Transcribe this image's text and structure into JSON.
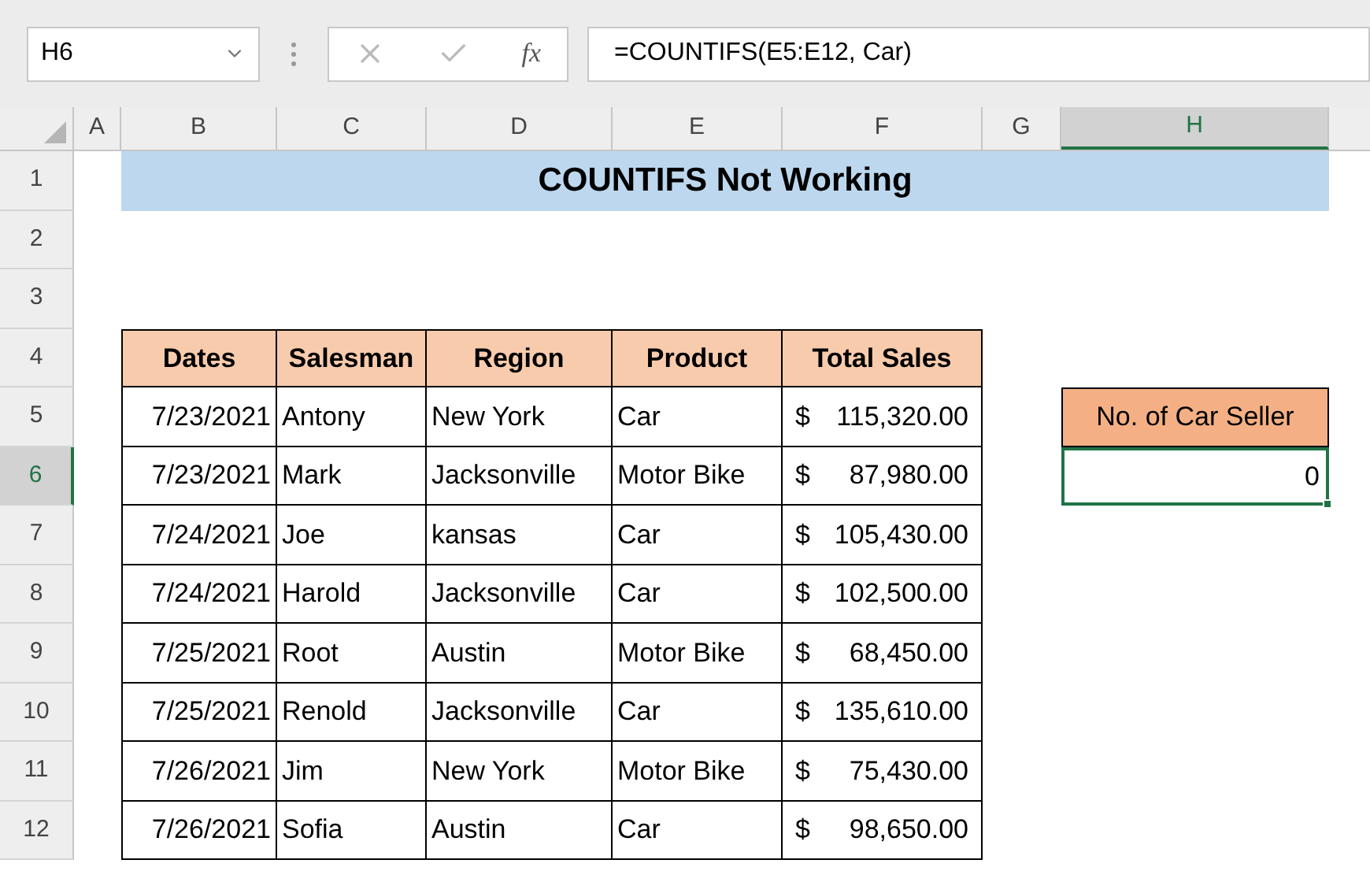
{
  "name_box": {
    "value": "H6"
  },
  "formula_bar": {
    "function_label": "fx",
    "formula": "=COUNTIFS(E5:E12, Car)"
  },
  "columns": [
    {
      "label": "A",
      "selected": false
    },
    {
      "label": "B",
      "selected": false
    },
    {
      "label": "C",
      "selected": false
    },
    {
      "label": "D",
      "selected": false
    },
    {
      "label": "E",
      "selected": false
    },
    {
      "label": "F",
      "selected": false
    },
    {
      "label": "G",
      "selected": false
    },
    {
      "label": "H",
      "selected": true
    }
  ],
  "rows": [
    {
      "label": "1",
      "selected": false
    },
    {
      "label": "2",
      "selected": false
    },
    {
      "label": "3",
      "selected": false
    },
    {
      "label": "4",
      "selected": false
    },
    {
      "label": "5",
      "selected": false
    },
    {
      "label": "6",
      "selected": true
    },
    {
      "label": "7",
      "selected": false
    },
    {
      "label": "8",
      "selected": false
    },
    {
      "label": "9",
      "selected": false
    },
    {
      "label": "10",
      "selected": false
    },
    {
      "label": "11",
      "selected": false
    },
    {
      "label": "12",
      "selected": false
    }
  ],
  "title": "COUNTIFS Not Working",
  "table": {
    "columns": [
      "Dates",
      "Salesman",
      "Region",
      "Product",
      "Total Sales"
    ],
    "rows": [
      {
        "date": "7/23/2021",
        "salesman": "Antony",
        "region": "New York",
        "product": "Car",
        "sales": {
          "symbol": "$",
          "amount": "115,320.00"
        }
      },
      {
        "date": "7/23/2021",
        "salesman": "Mark",
        "region": "Jacksonville",
        "product": "Motor Bike",
        "sales": {
          "symbol": "$",
          "amount": "87,980.00"
        }
      },
      {
        "date": "7/24/2021",
        "salesman": "Joe",
        "region": "kansas",
        "product": "Car",
        "sales": {
          "symbol": "$",
          "amount": "105,430.00"
        }
      },
      {
        "date": "7/24/2021",
        "salesman": "Harold",
        "region": "Jacksonville",
        "product": "Car",
        "sales": {
          "symbol": "$",
          "amount": "102,500.00"
        }
      },
      {
        "date": "7/25/2021",
        "salesman": "Root",
        "region": "Austin",
        "product": "Motor Bike",
        "sales": {
          "symbol": "$",
          "amount": "68,450.00"
        }
      },
      {
        "date": "7/25/2021",
        "salesman": "Renold",
        "region": "Jacksonville",
        "product": "Car",
        "sales": {
          "symbol": "$",
          "amount": "135,610.00"
        }
      },
      {
        "date": "7/26/2021",
        "salesman": "Jim",
        "region": "New York",
        "product": "Motor Bike",
        "sales": {
          "symbol": "$",
          "amount": "75,430.00"
        }
      },
      {
        "date": "7/26/2021",
        "salesman": "Sofia",
        "region": "Austin",
        "product": "Car",
        "sales": {
          "symbol": "$",
          "amount": "98,650.00"
        }
      }
    ]
  },
  "result": {
    "header": "No. of Car Seller",
    "value": "0",
    "selected": true
  }
}
